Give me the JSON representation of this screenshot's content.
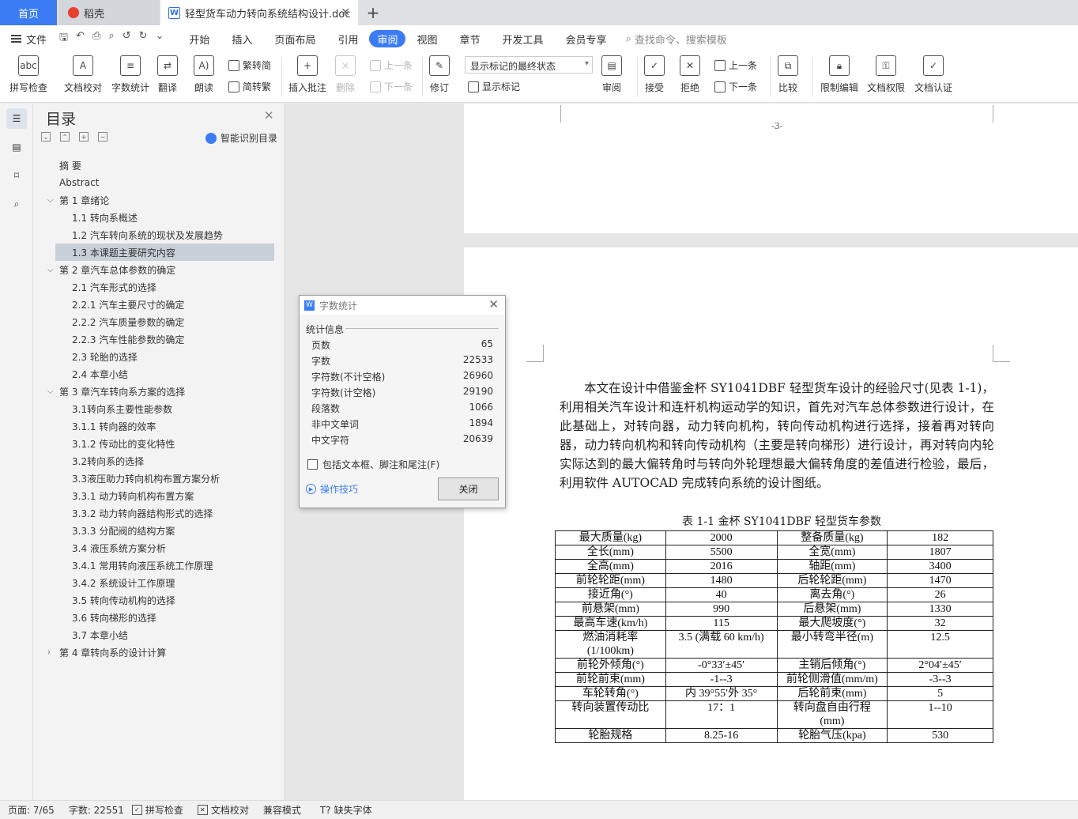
{
  "tabs": {
    "home": "首页",
    "daoke": "稻壳",
    "doc": "轻型货车动力转向系统结构设计.doc",
    "add": "+"
  },
  "menu": {
    "file": "文件",
    "quick_icons": [
      "save-icon",
      "undo-icon",
      "print-icon",
      "preview-icon",
      "undo-icon",
      "redo-icon"
    ],
    "tabs": [
      "开始",
      "插入",
      "页面布局",
      "引用",
      "审阅",
      "视图",
      "章节",
      "开发工具",
      "会员专享"
    ],
    "active_tab": "审阅",
    "search": "查找命令、搜索模板"
  },
  "ribbon": {
    "spellcheck": "拼写检查",
    "proofread": "文档校对",
    "wordcount": "字数统计",
    "translate": "翻译",
    "read": "朗读",
    "trad": "繁转简",
    "simp": "简转繁",
    "insert_comment": "插入批注",
    "delete": "删除",
    "prev": "上一条",
    "next": "下一条",
    "track": "修订",
    "mark_state": "显示标记的最终状态",
    "show_marks": "显示标记",
    "review": "审阅",
    "accept": "接受",
    "reject": "拒绝",
    "prev2": "上一条",
    "next2": "下一条",
    "compare": "比较",
    "restrict": "限制编辑",
    "rights": "文档权限",
    "certify": "文档认证"
  },
  "toc": {
    "title": "目录",
    "smart": "智能识别目录",
    "items": [
      {
        "label": "摘  要",
        "level": 0
      },
      {
        "label": "Abstract",
        "level": 0
      },
      {
        "label": "第 1 章绪论",
        "level": 1,
        "caret": "v"
      },
      {
        "label": "1.1 转向系概述",
        "level": 2
      },
      {
        "label": "1.2 汽车转向系统的现状及发展趋势",
        "level": 2
      },
      {
        "label": "1.3  本课题主要研究内容",
        "level": 2,
        "selected": true
      },
      {
        "label": "第 2 章汽车总体参数的确定",
        "level": 1,
        "caret": "v"
      },
      {
        "label": "2.1 汽车形式的选择",
        "level": 2
      },
      {
        "label": "2.2.1 汽车主要尺寸的确定",
        "level": 2
      },
      {
        "label": "2.2.2 汽车质量参数的确定",
        "level": 2
      },
      {
        "label": "2.2.3 汽车性能参数的确定",
        "level": 2
      },
      {
        "label": "2.3 轮胎的选择",
        "level": 2
      },
      {
        "label": "2.4 本章小结",
        "level": 2
      },
      {
        "label": "第 3 章汽车转向系方案的选择",
        "level": 1,
        "caret": "v"
      },
      {
        "label": "3.1转向系主要性能参数",
        "level": 2
      },
      {
        "label": "3.1.1 转向器的效率",
        "level": 2
      },
      {
        "label": "3.1.2 传动比的变化特性",
        "level": 2
      },
      {
        "label": "3.2转向系的选择",
        "level": 2
      },
      {
        "label": "3.3液压助力转向机构布置方案分析",
        "level": 2
      },
      {
        "label": "3.3.1 动力转向机构布置方案",
        "level": 2
      },
      {
        "label": "3.3.2 动力转向器结构形式的选择",
        "level": 2
      },
      {
        "label": "3.3.3 分配阀的结构方案",
        "level": 2
      },
      {
        "label": "3.4 液压系统方案分析",
        "level": 2
      },
      {
        "label": "3.4.1 常用转向液压系统工作原理",
        "level": 2
      },
      {
        "label": "3.4.2 系统设计工作原理",
        "level": 2
      },
      {
        "label": "3.5 转向传动机构的选择",
        "level": 2
      },
      {
        "label": "3.6 转向梯形的选择",
        "level": 2
      },
      {
        "label": "3.7 本章小结",
        "level": 2
      },
      {
        "label": "第 4 章转向系的设计计算",
        "level": 1,
        "caret": ">"
      }
    ]
  },
  "document": {
    "page_number": "-3-",
    "paragraph": "本文在设计中借鉴金杯 SY1041DBF 轻型货车设计的经验尺寸(见表 1-1)，利用相关汽车设计和连杆机构运动学的知识，首先对汽车总体参数进行设计，在此基础上，对转向器，动力转向机构，转向传动机构进行选择，接着再对转向器，动力转向机构和转向传动机构（主要是转向梯形）进行设计，再对转向内轮实际达到的最大偏转角时与转向外轮理想最大偏转角度的差值进行检验，最后，利用软件 AUTOCAD 完成转向系统的设计图纸。",
    "table_caption": "表 1-1 金杯 SY1041DBF 轻型货车参数",
    "table_rows": [
      [
        "最大质量(kg)",
        "2000",
        "整备质量(kg)",
        "182"
      ],
      [
        "全长(mm)",
        "5500",
        "全宽(mm)",
        "1807"
      ],
      [
        "全高(mm)",
        "2016",
        "轴距(mm)",
        "3400"
      ],
      [
        "前轮轮距(mm)",
        "1480",
        "后轮轮距(mm)",
        "1470"
      ],
      [
        "接近角(°)",
        "40",
        "离去角(°)",
        "26"
      ],
      [
        "前悬架(mm)",
        "990",
        "后悬架(mm)",
        "1330"
      ],
      [
        "最高车速(km/h)",
        "115",
        "最大爬坡度(°)",
        "32"
      ],
      [
        "燃油消耗率\n(1/100km)",
        "3.5 (满载 60 km/h)",
        "最小转弯半径(m)",
        "12.5"
      ],
      [
        "前轮外倾角(°)",
        "-0°33′±45′",
        "主销后倾角(°)",
        "2°04′±45′"
      ],
      [
        "前轮前束(mm)",
        "-1--3",
        "前轮侧滑值(mm/m)",
        "-3--3"
      ],
      [
        "车轮转角(°)",
        "内 39°55′外 35°",
        "后轮前束(mm)",
        "5"
      ],
      [
        "转向装置传动比",
        "17：1",
        "转向盘自由行程\n(mm)",
        "1--10"
      ],
      [
        "轮胎规格",
        "8.25-16",
        "轮胎气压(kpa)",
        "530"
      ]
    ]
  },
  "dialog": {
    "title": "字数统计",
    "section": "统计信息",
    "stats": [
      {
        "label": "页数",
        "value": "65"
      },
      {
        "label": "字数",
        "value": "22533"
      },
      {
        "label": "字符数(不计空格)",
        "value": "26960"
      },
      {
        "label": "字符数(计空格)",
        "value": "29190"
      },
      {
        "label": "段落数",
        "value": "1066"
      },
      {
        "label": "非中文单词",
        "value": "1894"
      },
      {
        "label": "中文字符",
        "value": "20639"
      }
    ],
    "checkbox": "包括文本框、脚注和尾注(F)",
    "checkbox_checked": false,
    "tips": "操作技巧",
    "close": "关闭"
  },
  "statusbar": {
    "page": "页面: 7/65",
    "words": "字数: 22551",
    "spell": "拼写检查",
    "proof": "文档校对",
    "compat": "兼容模式",
    "missing_font": "缺失字体"
  }
}
